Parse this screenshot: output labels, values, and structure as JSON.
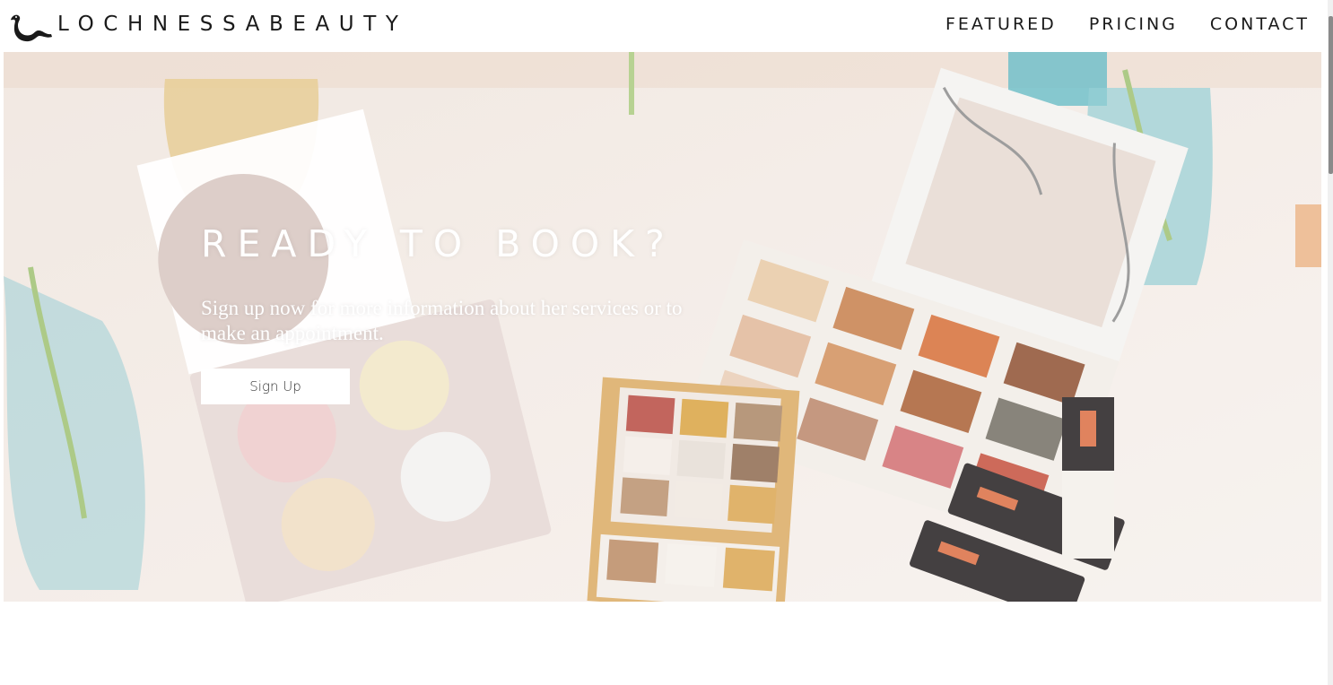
{
  "header": {
    "brand": "LOCHNESSABEAUTY",
    "logo_icon": "loch-ness-monster-icon",
    "nav": [
      {
        "label": "FEATURED"
      },
      {
        "label": "PRICING"
      },
      {
        "label": "CONTACT"
      }
    ]
  },
  "hero": {
    "background": "makeup-palettes-photo",
    "title": "READY TO BOOK?",
    "text": "Sign up now for more information about her services or to make an appointment.",
    "button_label": "Sign Up"
  },
  "colors": {
    "text_dark": "#1a1a1a",
    "hero_text": "#ffffff",
    "button_bg": "#ffffff"
  }
}
